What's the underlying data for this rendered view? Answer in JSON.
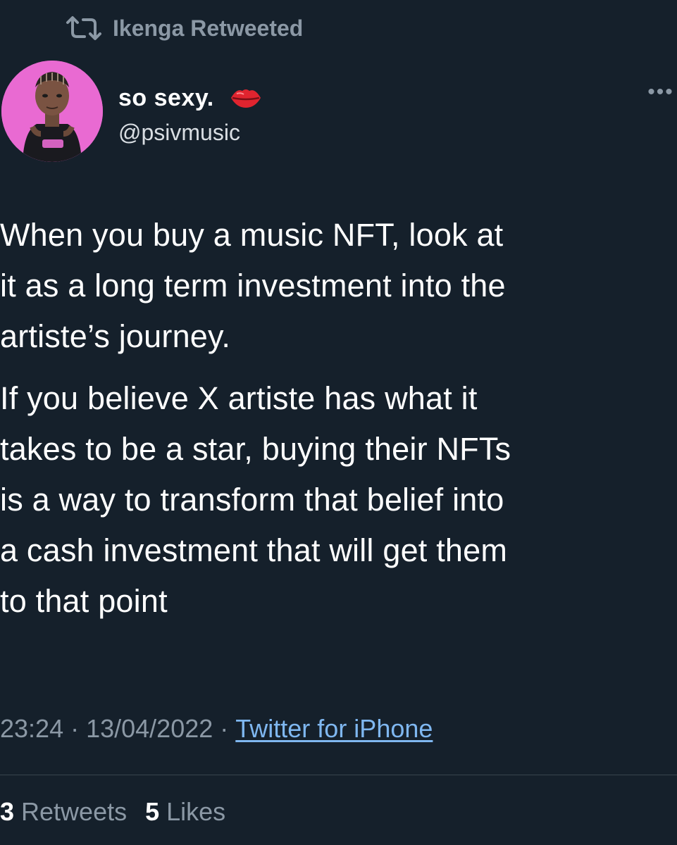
{
  "retweet_header": {
    "icon": "retweet-icon",
    "text": "Ikenga Retweeted"
  },
  "author": {
    "display_name": "so sexy.",
    "name_emoji": "lips-icon",
    "handle": "@psivmusic",
    "avatar": "avatar-cartoon-portrait"
  },
  "more_menu": {
    "icon": "more-options-icon",
    "label": "•••"
  },
  "tweet": {
    "paragraphs": [
      "When you buy a music NFT, look at\nit as a long term investment into the\nartiste’s journey.",
      "If you believe X artiste has what it\ntakes to be a star, buying their NFTs\nis a way to transform  that belief into\na cash investment that will get them\nto that point"
    ]
  },
  "meta": {
    "time": "23:24",
    "separator": "·",
    "date": "13/04/2022",
    "source": "Twitter for iPhone"
  },
  "stats": {
    "retweets_count": "3",
    "retweets_label": "Retweets",
    "likes_count": "5",
    "likes_label": "Likes"
  },
  "colors": {
    "background": "#15202b",
    "secondary_text": "#8b98a5",
    "link": "#7fb7f0",
    "avatar_bg": "#e96ad2"
  }
}
